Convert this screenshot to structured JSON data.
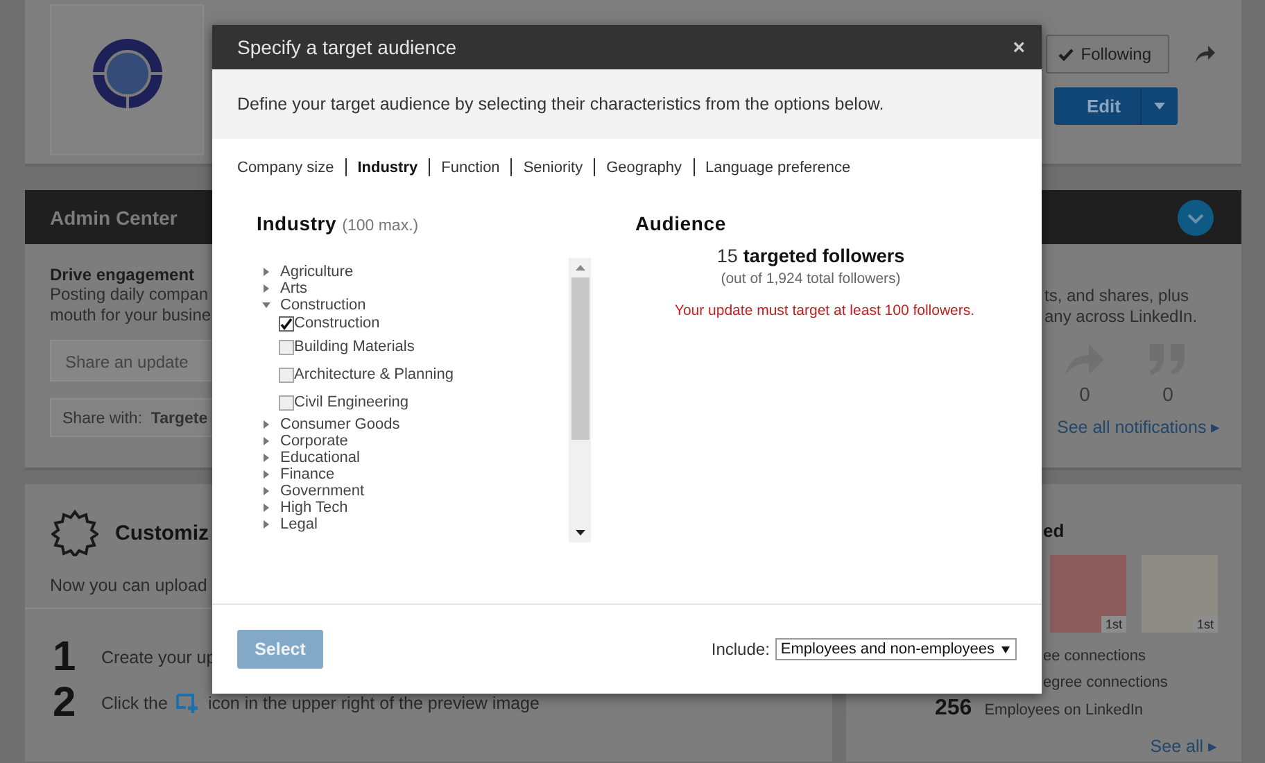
{
  "page": {
    "header": {
      "following_button": "Following",
      "edit_button": "Edit"
    },
    "admin_center": {
      "title": "Admin Center",
      "expanded": false
    },
    "engagement": {
      "title": "Drive engagement",
      "lines": [
        "Posting daily compan",
        "mouth for your busine"
      ],
      "share_placeholder": "Share an update",
      "share_with": "Share with:  **Targete**",
      "right_lines": [
        "ts, and shares, plus",
        "any across LinkedIn."
      ],
      "counts": [
        "0",
        "0"
      ],
      "see_all_notifications": "See all notifications ▸"
    },
    "customize": {
      "title": "Customiz",
      "intro": "Now you can upload",
      "steps": [
        {
          "number": "1",
          "text": "Create your up"
        },
        {
          "number": "2",
          "text_before": "Click the",
          "text_after": "icon in the upper right of the preview image"
        }
      ]
    },
    "connections": {
      "title": "ed",
      "photos": [
        {
          "badge": "1st"
        },
        {
          "badge": "1st"
        }
      ],
      "lines": [
        "ee connections",
        "egree connections"
      ],
      "employees_count": "256",
      "employees_label": "Employees on LinkedIn",
      "see_all": "See all ▸"
    }
  },
  "dialog": {
    "title": "Specify a target audience",
    "close": "×",
    "description": "Define your target audience by selecting their characteristics from the options below.",
    "tabs": [
      {
        "label": "Company size",
        "selected": false
      },
      {
        "label": "Industry",
        "selected": true
      },
      {
        "label": "Function",
        "selected": false
      },
      {
        "label": "Seniority",
        "selected": false
      },
      {
        "label": "Geography",
        "selected": false
      },
      {
        "label": "Language preference",
        "selected": false
      }
    ],
    "list_title": "Industry",
    "list_limit": "(100 max.)",
    "industries": [
      {
        "label": "Agriculture",
        "expanded": false
      },
      {
        "label": "Arts",
        "expanded": false
      },
      {
        "label": "Construction",
        "expanded": true,
        "children": [
          {
            "label": "Construction",
            "checked": true
          },
          {
            "label": "Building Materials",
            "checked": false
          },
          {
            "label": "Architecture & Planning",
            "checked": false
          },
          {
            "label": "Civil Engineering",
            "checked": false
          }
        ]
      },
      {
        "label": "Consumer Goods",
        "expanded": false
      },
      {
        "label": "Corporate",
        "expanded": false
      },
      {
        "label": "Educational",
        "expanded": false
      },
      {
        "label": "Finance",
        "expanded": false
      },
      {
        "label": "Government",
        "expanded": false
      },
      {
        "label": "High Tech",
        "expanded": false
      },
      {
        "label": "Legal",
        "expanded": false
      }
    ],
    "audience": {
      "title": "Audience",
      "count": "15",
      "count_label": "targeted followers",
      "total": "(out of 1,924 total followers)",
      "warning": "Your update must target at least 100 followers."
    },
    "select_button": {
      "label": "Select",
      "disabled": true
    },
    "include_label": "Include:",
    "include_value": "Employees and non-employees"
  }
}
